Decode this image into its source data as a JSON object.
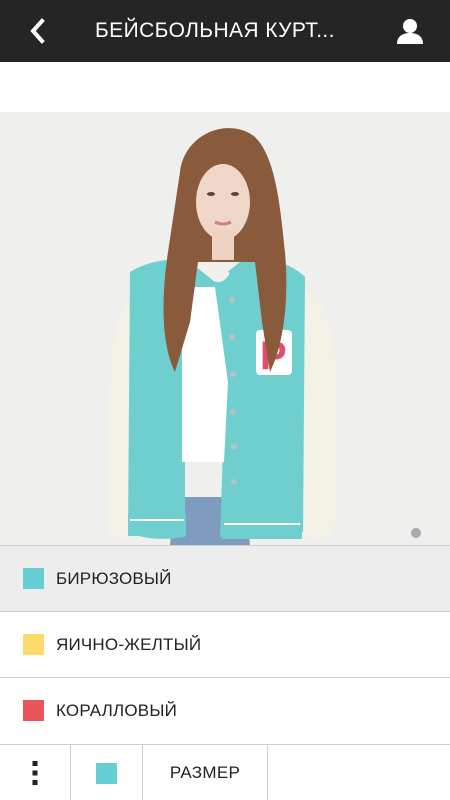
{
  "header": {
    "title": "БЕЙСБОЛЬНАЯ КУРТ...",
    "back_icon": "chevron-left-icon",
    "user_icon": "user-icon"
  },
  "product_image": {
    "description_icon": "product-photo",
    "pager": {
      "current_page": 1,
      "total_pages": 2
    }
  },
  "colors": [
    {
      "label": "БИРЮЗОВЫЙ",
      "swatch": "#67cfd4",
      "selected": true
    },
    {
      "label": "ЯИЧНО-ЖЕЛТЫЙ",
      "swatch": "#fcdb6c",
      "selected": false
    },
    {
      "label": "КОРАЛЛОВЫЙ",
      "swatch": "#e9545a",
      "selected": false
    }
  ],
  "bottom_bar": {
    "menu_icon": "more-vertical-icon",
    "selected_color_swatch": "#67cfd4",
    "size_label": "РАЗМЕР"
  },
  "theme": {
    "header_bg": "#252525",
    "divider": "#cfcfcf",
    "selected_row_bg": "#ededed"
  }
}
